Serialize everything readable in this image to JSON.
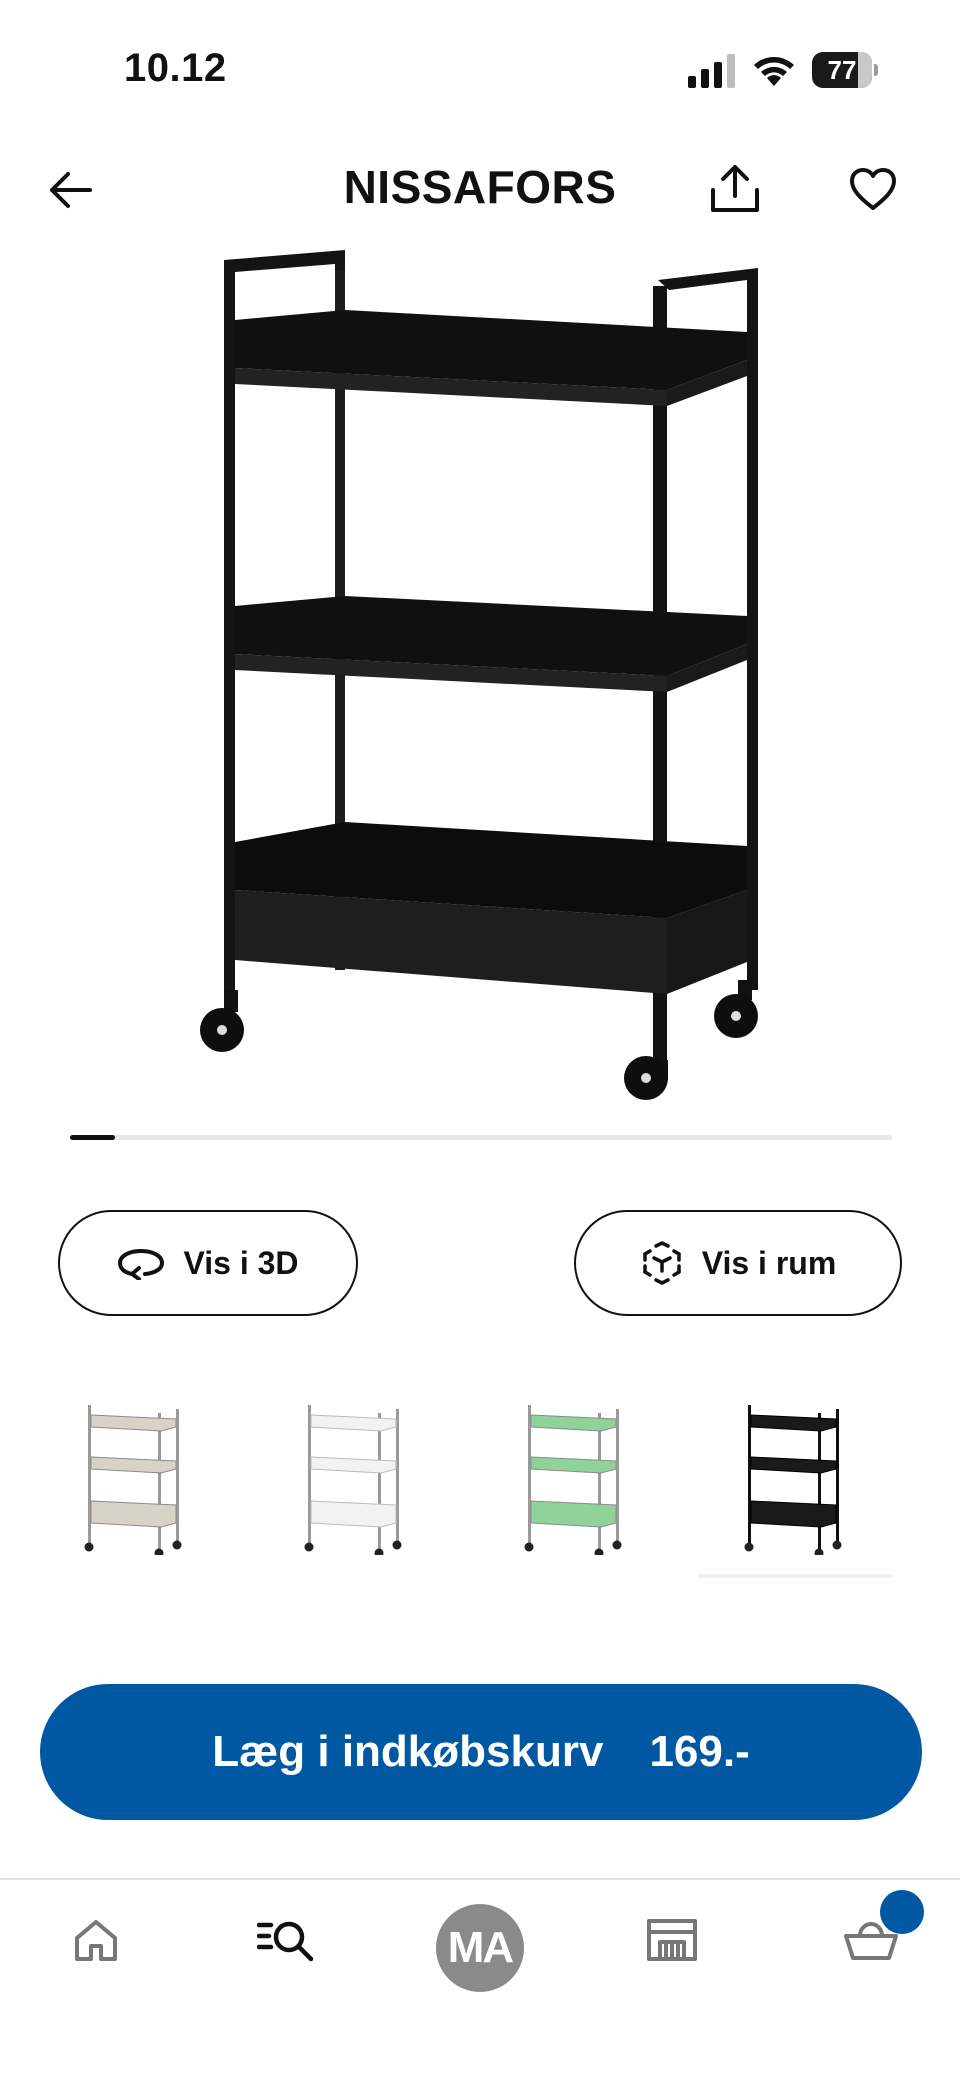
{
  "status_bar": {
    "time": "10.12",
    "battery_level": "77",
    "battery_fraction": 0.77
  },
  "header": {
    "title": "NISSAFORS",
    "back_icon": "arrow-left-icon",
    "share_icon": "share-icon",
    "favorite_icon": "heart-icon"
  },
  "product": {
    "image_icon": "trolley-image",
    "color": "#141414",
    "carousel": {
      "current": 1,
      "total": 12
    }
  },
  "actions": {
    "view_3d_label": "Vis i 3D",
    "view_in_room_label": "Vis i rum",
    "view_3d_icon": "rotate-3d-icon",
    "view_in_room_icon": "ar-cube-icon"
  },
  "variants": [
    {
      "name": "beige",
      "color": "#d9d2c7"
    },
    {
      "name": "white",
      "color": "#f2f2f2"
    },
    {
      "name": "green",
      "color": "#8fd39a"
    },
    {
      "name": "black",
      "color": "#1a1a1a",
      "selected": true
    }
  ],
  "cta": {
    "label": "Læg i indkøbskurv",
    "price": "169.-",
    "color": "#0058a3"
  },
  "bottom_nav": {
    "home_icon": "home-icon",
    "search_icon": "search-list-icon",
    "profile_initials": "MA",
    "store_icon": "store-icon",
    "cart_icon": "basket-icon",
    "cart_badge_color": "#0058a3"
  }
}
